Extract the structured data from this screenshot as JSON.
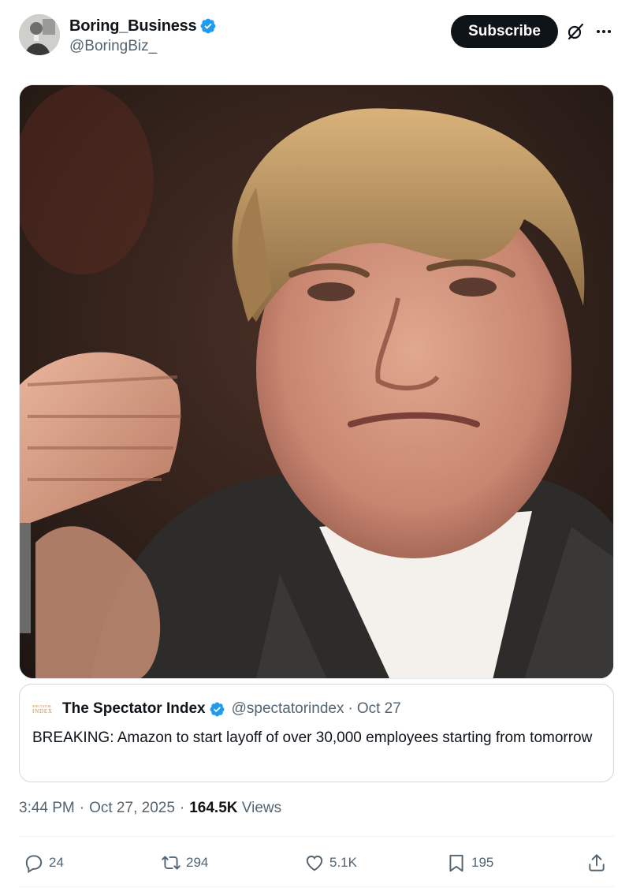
{
  "author": {
    "display_name": "Boring_Business",
    "handle": "@BoringBiz_",
    "verified": true
  },
  "header": {
    "subscribe_label": "Subscribe",
    "grok_icon": "grok-slash-icon",
    "more_icon": "more-dots-icon"
  },
  "media": {
    "alt": "Close-up of a man with tousled blond hair in a dark suit and white shirt, gesturing with his hand"
  },
  "quote": {
    "logo_line1": "SPECTATOR",
    "logo_line2": "INDEX",
    "name": "The Spectator Index",
    "handle": "@spectatorindex",
    "dot": "·",
    "date": "Oct 27",
    "text": "BREAKING: Amazon to start layoff of over 30,000 employees starting from tomorrow"
  },
  "meta": {
    "time": "3:44 PM",
    "sep": "·",
    "date": "Oct 27, 2025",
    "views_count": "164.5K",
    "views_label": "Views"
  },
  "actions": {
    "replies": "24",
    "retweets": "294",
    "likes": "5.1K",
    "bookmarks": "195"
  },
  "colors": {
    "verified_blue": "#1d9bf0",
    "text_primary": "#0f1419",
    "text_secondary": "#536471",
    "button_dark": "#0f1419"
  }
}
